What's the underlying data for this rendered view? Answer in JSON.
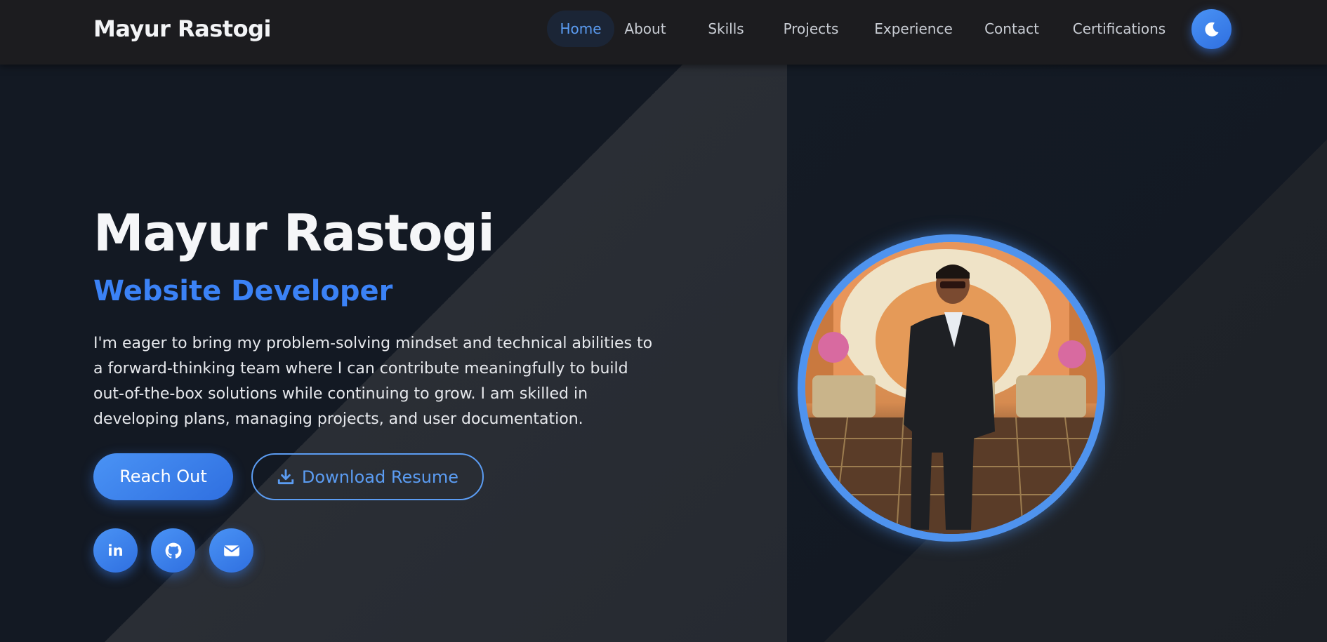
{
  "nav": {
    "brand": "Mayur Rastogi",
    "links": [
      "Home",
      "About",
      "Skills",
      "Projects",
      "Experience",
      "Contact",
      "Certifications"
    ],
    "active": "Home"
  },
  "hero": {
    "name": "Mayur Rastogi",
    "role": "Website Developer",
    "description": "I'm eager to bring my problem-solving mindset and technical abilities to a forward-thinking team where I can contribute meaningfully to build out-of-the-box solutions while continuing to grow. I am skilled in developing plans, managing projects, and user documentation.",
    "primary_button": "Reach Out",
    "secondary_button": "Download Resume",
    "social_icons": [
      "linkedin-icon",
      "github-icon",
      "mail-icon"
    ]
  },
  "colors": {
    "accent": "#3b82f6",
    "nav_bg": "#1c1c1f",
    "page_bg": "#131923"
  }
}
